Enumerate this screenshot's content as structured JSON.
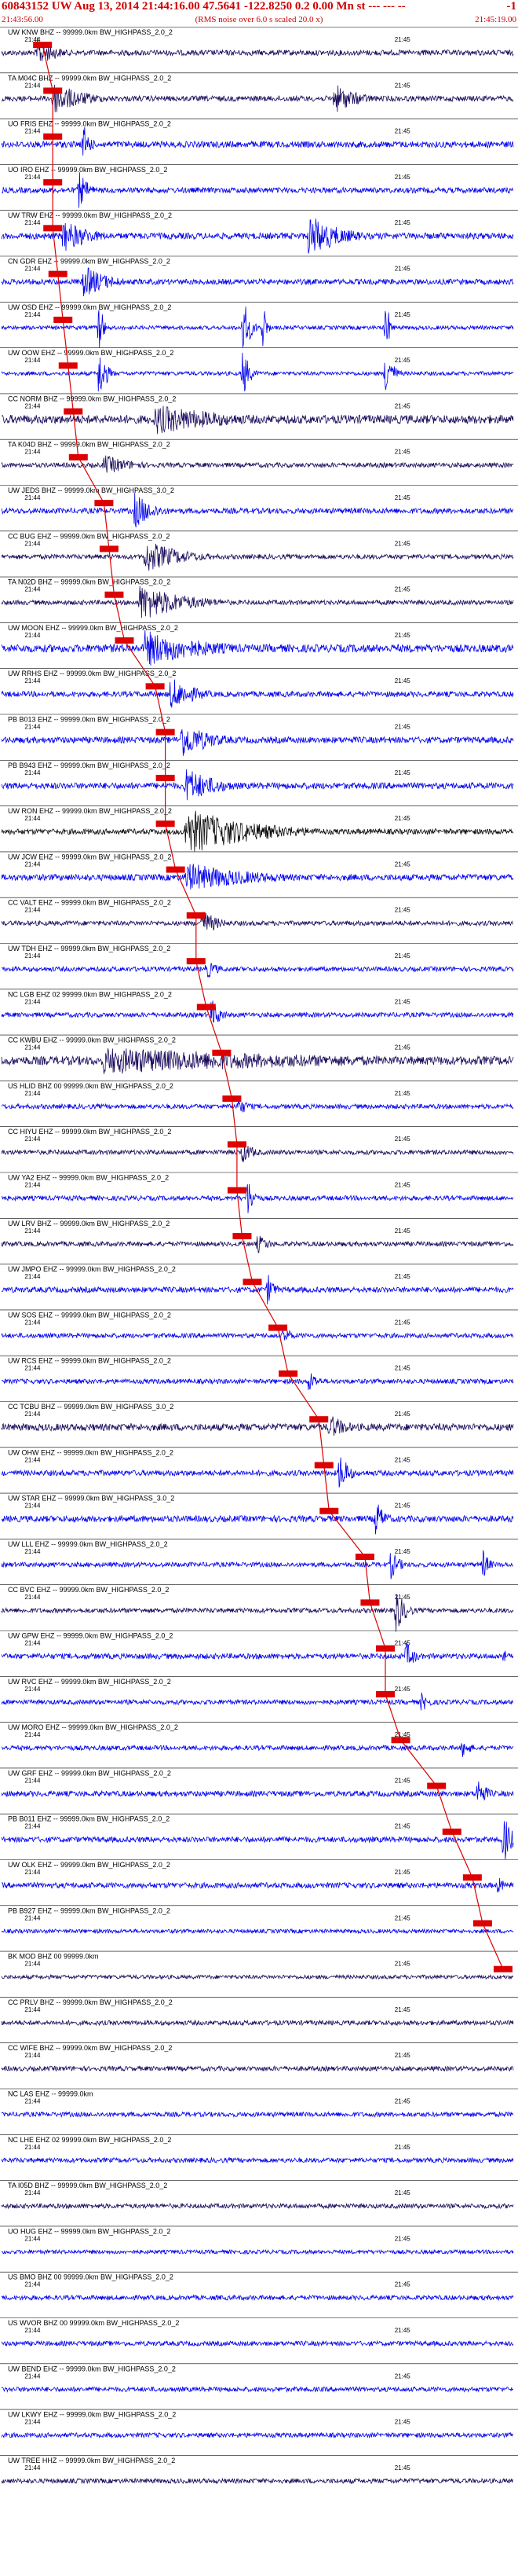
{
  "header": {
    "title": "60843152 UW Aug 13, 2014 21:44:16.00   47.5641 -122.8250  0.2 0.00 Mn st --- --- --",
    "right_mark": "-1",
    "start_time": "21:43:56.00",
    "end_time": "21:45:19.00",
    "note": "(RMS noise over 6.0 s scaled 20.0 x)"
  },
  "chart_data": {
    "type": "line",
    "time_range": [
      "21:43:56.00",
      "21:45:19.00"
    ],
    "minute_labels": [
      "21:44",
      "21:45"
    ],
    "colors": {
      "trace_dark": "#1a0a5a",
      "trace_blue": "#0000ee",
      "pick": "#dd0000",
      "grid": "#000000"
    },
    "series": [
      {
        "name": "UW KNW BHZ -- 99999.0km BW HIGHPASS 2.0 2",
        "label": "UW KNW BHZ -- 99999.0km BW_HIGHPASS_2.0_2",
        "color": "#1a0a5a",
        "amp": 0.35,
        "events": [
          [
            0.07,
            0.9,
            6
          ]
        ]
      },
      {
        "name": "TA M04C BHZ -- 99999.0km BW HIGHPASS 2.0 2",
        "label": "TA M04C BHZ -- 99999.0km BW_HIGHPASS_2.0_2",
        "color": "#1a0a5a",
        "amp": 0.35,
        "events": [
          [
            0.1,
            1.0,
            10
          ],
          [
            0.65,
            0.9,
            8
          ]
        ]
      },
      {
        "name": "UO FRIS EHZ -- 99999.0km BW HIGHPASS 2.0 2",
        "label": "UO FRIS EHZ -- 99999.0km BW_HIGHPASS_2.0_2",
        "color": "#0000ee",
        "amp": 0.4,
        "events": [
          [
            0.16,
            1.3,
            2
          ]
        ]
      },
      {
        "name": "UO IRO EHZ -- 99999.0km BW HIGHPASS 2.0 2",
        "label": "UO IRO EHZ -- 99999.0km BW_HIGHPASS_2.0_2",
        "color": "#0000ee",
        "amp": 0.35,
        "events": [
          [
            0.15,
            1.2,
            3
          ]
        ]
      },
      {
        "name": "UW TRW EHZ -- 99999.0km BW HIGHPASS 2.0 2",
        "label": "UW TRW EHZ -- 99999.0km BW_HIGHPASS_2.0_2",
        "color": "#0000ee",
        "amp": 0.4,
        "events": [
          [
            0.12,
            1.0,
            9
          ],
          [
            0.6,
            1.3,
            10
          ]
        ]
      },
      {
        "name": "CN GDR EHZ -- 99999.0km BW HIGHPASS 2.0 2",
        "label": "CN GDR EHZ -- 99999.0km BW_HIGHPASS_2.0_2",
        "color": "#0000ee",
        "amp": 0.35,
        "events": [
          [
            0.16,
            1.0,
            8
          ]
        ]
      },
      {
        "name": "UW OSD EHZ -- 99999.0km BW HIGHPASS 2.0 2",
        "label": "UW OSD EHZ -- 99999.0km BW_HIGHPASS_2.0_2",
        "color": "#0000ee",
        "amp": 0.25,
        "events": [
          [
            0.19,
            2.6,
            1
          ],
          [
            0.47,
            2.4,
            2
          ],
          [
            0.51,
            2.2,
            1
          ],
          [
            0.75,
            2.6,
            1
          ]
        ]
      },
      {
        "name": "UW OOW EHZ -- 99999.0km BW HIGHPASS 2.0 2",
        "label": "UW OOW EHZ -- 99999.0km BW_HIGHPASS_2.0_2",
        "color": "#0000ee",
        "amp": 0.25,
        "events": [
          [
            0.19,
            2.0,
            2
          ],
          [
            0.47,
            1.8,
            2
          ],
          [
            0.75,
            2.0,
            2
          ]
        ]
      },
      {
        "name": "CC NORM BHZ -- 99999.0km BW HIGHPASS 2.0 2",
        "label": "CC NORM BHZ -- 99999.0km BW_HIGHPASS_2.0_2",
        "color": "#1a0a5a",
        "amp": 0.55,
        "events": [
          [
            0.3,
            0.9,
            25
          ]
        ]
      },
      {
        "name": "TA K04D BHZ -- 99999.0km BW HIGHPASS 2.0 2",
        "label": "TA K04D BHZ -- 99999.0km BW_HIGHPASS_2.0_2",
        "color": "#1a0a5a",
        "amp": 0.3,
        "events": [
          [
            0.2,
            0.6,
            10
          ]
        ]
      },
      {
        "name": "UW JEDS BHZ -- 99999.0km BW HIGHPASS 3.0 2",
        "label": "UW JEDS BHZ -- 99999.0km BW_HIGHPASS_3.0_2",
        "color": "#0000ee",
        "amp": 0.35,
        "events": [
          [
            0.26,
            1.1,
            6
          ]
        ]
      },
      {
        "name": "CC BUG EHZ -- 99999.0km BW HIGHPASS 2.0 2",
        "label": "CC BUG EHZ -- 99999.0km BW_HIGHPASS_2.0_2",
        "color": "#1a0a5a",
        "amp": 0.3,
        "events": [
          [
            0.28,
            1.0,
            12
          ]
        ]
      },
      {
        "name": "TA N02D BHZ -- 99999.0km BW HIGHPASS 2.0 2",
        "label": "TA N02D BHZ -- 99999.0km BW_HIGHPASS_2.0_2",
        "color": "#1a0a5a",
        "amp": 0.3,
        "events": [
          [
            0.27,
            1.1,
            15
          ]
        ]
      },
      {
        "name": "UW MOON EHZ -- 99999.0km BW HIGHPASS 2.0 2",
        "label": "UW MOON EHZ -- 99999.0km BW_HIGHPASS_2.0_2",
        "color": "#0000ee",
        "amp": 0.5,
        "events": [
          [
            0.28,
            1.1,
            20
          ]
        ]
      },
      {
        "name": "UW RRHS EHZ -- 99999.0km BW HIGHPASS 2.0 2",
        "label": "UW RRHS EHZ -- 99999.0km BW_HIGHPASS_2.0_2",
        "color": "#0000ee",
        "amp": 0.35,
        "events": [
          [
            0.33,
            1.0,
            8
          ]
        ]
      },
      {
        "name": "PB B013 EHZ -- 99999.0km BW HIGHPASS 2.0 2",
        "label": "PB B013 EHZ -- 99999.0km BW_HIGHPASS_2.0_2",
        "color": "#0000ee",
        "amp": 0.4,
        "events": [
          [
            0.35,
            1.1,
            10
          ]
        ]
      },
      {
        "name": "PB B943 EHZ -- 99999.0km BW HIGHPASS 2.0 2",
        "label": "PB B943 EHZ -- 99999.0km BW_HIGHPASS_2.0_2",
        "color": "#0000ee",
        "amp": 0.4,
        "events": [
          [
            0.36,
            1.1,
            10
          ]
        ]
      },
      {
        "name": "UW RON EHZ -- 99999.0km BW HIGHPASS 2.0 2",
        "label": "UW RON EHZ -- 99999.0km BW_HIGHPASS_2.0_2",
        "color": "#0a0a0a",
        "amp": 0.35,
        "events": [
          [
            0.36,
            1.4,
            22
          ]
        ]
      },
      {
        "name": "UW JCW EHZ -- 99999.0km BW HIGHPASS 2.0 2",
        "label": "UW JCW EHZ -- 99999.0km BW_HIGHPASS_2.0_2",
        "color": "#0000ee",
        "amp": 0.4,
        "events": [
          [
            0.36,
            0.9,
            22
          ]
        ]
      },
      {
        "name": "CC VALT EHZ -- 99999.0km BW HIGHPASS 2.0 2",
        "label": "CC VALT EHZ -- 99999.0km BW_HIGHPASS_2.0_2",
        "color": "#1a0a5a",
        "amp": 0.3,
        "events": [
          [
            0.39,
            0.9,
            5
          ]
        ]
      },
      {
        "name": "UW TDH EHZ -- 99999.0km BW HIGHPASS 2.0 2",
        "label": "UW TDH EHZ -- 99999.0km BW_HIGHPASS_2.0_2",
        "color": "#0000ee",
        "amp": 0.3,
        "events": [
          [
            0.4,
            0.6,
            4
          ]
        ]
      },
      {
        "name": "NC LGB EHZ 02 99999.0km BW HIGHPASS 2.0 2",
        "label": "NC LGB EHZ 02 99999.0km BW_HIGHPASS_2.0_2",
        "color": "#0000ee",
        "amp": 0.3,
        "events": [
          [
            0.41,
            1.0,
            3
          ]
        ]
      },
      {
        "name": "CC KWBU EHZ -- 99999.0km BW HIGHPASS 2.0 2",
        "label": "CC KWBU EHZ -- 99999.0km BW_HIGHPASS_2.0_2",
        "color": "#1a0a5a",
        "amp": 0.55,
        "events": [
          [
            0.2,
            0.8,
            80
          ]
        ]
      },
      {
        "name": "US HLID BHZ 00 99999.0km BW HIGHPASS 2.0 2",
        "label": "US HLID BHZ 00 99999.0km BW_HIGHPASS_2.0_2",
        "color": "#0000ee",
        "amp": 0.3,
        "events": [
          [
            0.46,
            0.6,
            4
          ]
        ]
      },
      {
        "name": "CC HIYU EHZ -- 99999.0km BW HIGHPASS 2.0 2",
        "label": "CC HIYU EHZ -- 99999.0km BW_HIGHPASS_2.0_2",
        "color": "#1a0a5a",
        "amp": 0.3,
        "events": [
          [
            0.47,
            0.7,
            4
          ]
        ]
      },
      {
        "name": "UW YA2 EHZ -- 99999.0km BW HIGHPASS 2.0 2",
        "label": "UW YA2 EHZ -- 99999.0km BW_HIGHPASS_2.0_2",
        "color": "#0000ee",
        "amp": 0.3,
        "events": [
          [
            0.48,
            1.3,
            2
          ]
        ]
      },
      {
        "name": "UW LRV BHZ -- 99999.0km BW HIGHPASS 2.0 2",
        "label": "UW LRV BHZ -- 99999.0km BW_HIGHPASS_2.0_2",
        "color": "#1a0a5a",
        "amp": 0.3,
        "events": [
          [
            0.5,
            0.6,
            4
          ]
        ]
      },
      {
        "name": "UW JMPO EHZ -- 99999.0km BW HIGHPASS 2.0 2",
        "label": "UW JMPO EHZ -- 99999.0km BW_HIGHPASS_2.0_2",
        "color": "#0000ee",
        "amp": 0.35,
        "events": [
          [
            0.52,
            1.1,
            2
          ]
        ]
      },
      {
        "name": "UW SOS EHZ -- 99999.0km BW HIGHPASS 2.0 2",
        "label": "UW SOS EHZ -- 99999.0km BW_HIGHPASS_2.0_2",
        "color": "#0000ee",
        "amp": 0.3,
        "events": [
          [
            0.55,
            0.6,
            3
          ]
        ]
      },
      {
        "name": "UW RCS EHZ -- 99999.0km BW HIGHPASS 2.0 2",
        "label": "UW RCS EHZ -- 99999.0km BW_HIGHPASS_2.0_2",
        "color": "#0000ee",
        "amp": 0.3,
        "events": [
          [
            0.6,
            0.7,
            3
          ]
        ]
      },
      {
        "name": "CC TCBU BHZ -- 99999.0km BW HIGHPASS 3.0 2",
        "label": "CC TCBU BHZ -- 99999.0km BW_HIGHPASS_3.0_2",
        "color": "#1a0a5a",
        "amp": 0.45,
        "events": [
          [
            0.64,
            0.8,
            6
          ]
        ]
      },
      {
        "name": "UW OHW EHZ -- 99999.0km BW HIGHPASS 2.0 2",
        "label": "UW OHW EHZ -- 99999.0km BW_HIGHPASS_2.0_2",
        "color": "#0000ee",
        "amp": 0.35,
        "events": [
          [
            0.66,
            1.3,
            3
          ]
        ]
      },
      {
        "name": "UW STAR EHZ -- 99999.0km BW HIGHPASS 3.0 2",
        "label": "UW STAR EHZ -- 99999.0km BW_HIGHPASS_3.0_2",
        "color": "#0000ee",
        "amp": 0.4,
        "events": [
          [
            0.73,
            1.2,
            3
          ]
        ]
      },
      {
        "name": "UW LLL EHZ -- 99999.0km BW HIGHPASS 2.0 2",
        "label": "UW LLL EHZ -- 99999.0km BW_HIGHPASS_2.0_2",
        "color": "#0000ee",
        "amp": 0.3,
        "events": [
          [
            0.76,
            0.9,
            3
          ],
          [
            0.94,
            1.0,
            2
          ]
        ]
      },
      {
        "name": "CC BVC EHZ -- 99999.0km BW HIGHPASS 2.0 2",
        "label": "CC BVC EHZ -- 99999.0km BW_HIGHPASS_2.0_2",
        "color": "#1a0a5a",
        "amp": 0.3,
        "events": [
          [
            0.77,
            1.4,
            3
          ]
        ]
      },
      {
        "name": "UW GPW EHZ -- 99999.0km BW HIGHPASS 2.0 2",
        "label": "UW GPW EHZ -- 99999.0km BW_HIGHPASS_2.0_2",
        "color": "#0000ee",
        "amp": 0.35,
        "events": [
          [
            0.79,
            0.9,
            3
          ],
          [
            0.98,
            0.7,
            1
          ]
        ]
      },
      {
        "name": "UW RVC EHZ -- 99999.0km BW HIGHPASS 2.0 2",
        "label": "UW RVC EHZ -- 99999.0km BW_HIGHPASS_2.0_2",
        "color": "#0000ee",
        "amp": 0.3,
        "events": [
          [
            0.82,
            0.6,
            3
          ]
        ]
      },
      {
        "name": "UW MORO EHZ -- 99999.0km BW HIGHPASS 2.0 2",
        "label": "UW MORO EHZ -- 99999.0km BW_HIGHPASS_2.0_2",
        "color": "#0000ee",
        "amp": 0.3,
        "events": [
          [
            0.9,
            0.6,
            3
          ]
        ]
      },
      {
        "name": "UW GRF EHZ -- 99999.0km BW HIGHPASS 2.0 2",
        "label": "UW GRF EHZ -- 99999.0km BW_HIGHPASS_2.0_2",
        "color": "#0000ee",
        "amp": 0.35,
        "events": [
          [
            0.93,
            1.0,
            3
          ]
        ]
      },
      {
        "name": "PB B011 EHZ -- 99999.0km BW HIGHPASS 2.0 2",
        "label": "PB B011 EHZ -- 99999.0km BW_HIGHPASS_2.0_2",
        "color": "#0000ee",
        "amp": 0.35,
        "events": [
          [
            0.98,
            1.5,
            3
          ]
        ]
      },
      {
        "name": "UW OLK EHZ -- 99999.0km BW HIGHPASS 2.0 2",
        "label": "UW OLK EHZ -- 99999.0km BW_HIGHPASS_2.0_2",
        "color": "#0000ee",
        "amp": 0.35,
        "events": [
          [
            0.97,
            0.6,
            2
          ]
        ]
      },
      {
        "name": "PB B927 EHZ -- 99999.0km BW HIGHPASS 2.0 2",
        "label": "PB B927 EHZ -- 99999.0km BW_HIGHPASS_2.0_2",
        "color": "#0000ee",
        "amp": 0.25,
        "events": []
      },
      {
        "name": "BK MOD BHZ 00 99999.0km",
        "label": "BK MOD BHZ 00 99999.0km",
        "color": "#1a0a5a",
        "amp": 0.25,
        "events": []
      },
      {
        "name": "CC PRLV BHZ -- 99999.0km BW HIGHPASS 2.0 2",
        "label": "CC PRLV BHZ -- 99999.0km BW_HIGHPASS_2.0_2",
        "color": "#1a0a5a",
        "amp": 0.3,
        "events": []
      },
      {
        "name": "CC WIFE BHZ -- 99999.0km BW HIGHPASS 2.0 2",
        "label": "CC WIFE BHZ -- 99999.0km BW_HIGHPASS_2.0_2",
        "color": "#1a0a5a",
        "amp": 0.3,
        "events": []
      },
      {
        "name": "NC LAS EHZ -- 99999.0km",
        "label": "NC LAS EHZ -- 99999.0km",
        "color": "#0000ee",
        "amp": 0.3,
        "events": []
      },
      {
        "name": "NC LHE EHZ 02 99999.0km BW HIGHPASS 2.0 2",
        "label": "NC LHE EHZ 02 99999.0km BW_HIGHPASS_2.0_2",
        "color": "#0000ee",
        "amp": 0.3,
        "events": []
      },
      {
        "name": "TA I05D BHZ -- 99999.0km BW HIGHPASS 2.0 2",
        "label": "TA I05D BHZ -- 99999.0km BW_HIGHPASS_2.0_2",
        "color": "#1a0a5a",
        "amp": 0.3,
        "events": []
      },
      {
        "name": "UO HUG EHZ -- 99999.0km BW HIGHPASS 2.0 2",
        "label": "UO HUG EHZ -- 99999.0km BW_HIGHPASS_2.0_2",
        "color": "#0000ee",
        "amp": 0.25,
        "events": []
      },
      {
        "name": "US BMO BHZ 00 99999.0km BW HIGHPASS 2.0 2",
        "label": "US BMO BHZ 00 99999.0km BW_HIGHPASS_2.0_2",
        "color": "#0000ee",
        "amp": 0.3,
        "events": []
      },
      {
        "name": "US WVOR BHZ 00 99999.0km BW HIGHPASS 2.0 2",
        "label": "US WVOR BHZ 00 99999.0km BW_HIGHPASS_2.0_2",
        "color": "#0000ee",
        "amp": 0.3,
        "events": []
      },
      {
        "name": "UW BEND EHZ -- 99999.0km BW HIGHPASS 2.0 2",
        "label": "UW BEND EHZ -- 99999.0km BW_HIGHPASS_2.0_2",
        "color": "#0000ee",
        "amp": 0.3,
        "events": []
      },
      {
        "name": "UW LKWY EHZ -- 99999.0km BW HIGHPASS 2.0 2",
        "label": "UW LKWY EHZ -- 99999.0km BW_HIGHPASS_2.0_2",
        "color": "#0000ee",
        "amp": 0.3,
        "events": []
      },
      {
        "name": "UW TREE HHZ -- 99999.0km BW HIGHPASS 2.0 2",
        "label": "UW TREE HHZ -- 99999.0km BW_HIGHPASS_2.0_2",
        "color": "#1a0a5a",
        "amp": 0.3,
        "events": []
      }
    ],
    "picks": [
      0.08,
      0.1,
      0.1,
      0.1,
      0.1,
      0.11,
      0.12,
      0.13,
      0.14,
      0.15,
      0.2,
      0.21,
      0.22,
      0.24,
      0.3,
      0.32,
      0.32,
      0.32,
      0.34,
      0.38,
      0.38,
      0.4,
      0.43,
      0.45,
      0.46,
      0.46,
      0.47,
      0.49,
      0.54,
      0.56,
      0.62,
      0.63,
      0.64,
      0.71,
      0.72,
      0.75,
      0.75,
      0.78,
      0.85,
      0.88,
      0.92,
      0.94,
      0.98
    ]
  }
}
